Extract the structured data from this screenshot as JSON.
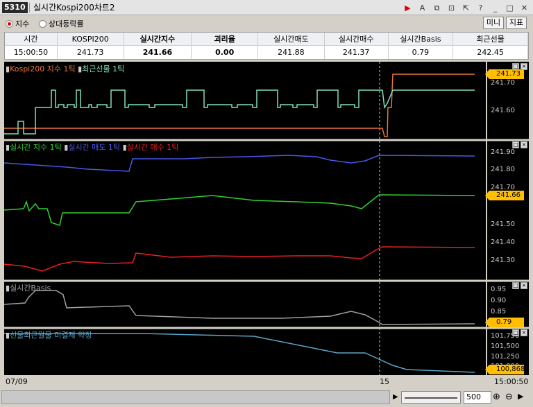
{
  "window": {
    "code": "5310",
    "title": "실시간Kospi200차트2"
  },
  "toolbar": {
    "radio1": "지수",
    "radio2": "상대등락률",
    "mini_btn": "미니",
    "indicator_btn": "지표"
  },
  "grid": {
    "headers": [
      "시간",
      "KOSPI200",
      "실시간지수",
      "괴리율",
      "실시간매도",
      "실시간매수",
      "실시간Basis",
      "최근선물"
    ],
    "values": [
      "15:00:50",
      "241.73",
      "241.66",
      "0.00",
      "241.88",
      "241.37",
      "0.79",
      "242.45"
    ]
  },
  "colors": {
    "kospi": "#e8743a",
    "futures": "#7fe0c0",
    "index": "#2fd22f",
    "sell": "#4a58e8",
    "buy": "#e81f1f",
    "basis": "#a0a0a0",
    "openint": "#5aa6c8",
    "tag": "#ffbf00"
  },
  "panel1": {
    "legend1": "Kospi200 지수 1틱",
    "legend2": "최근선물 1틱",
    "ticks": [
      "241.70",
      "241.60"
    ],
    "tag": "241.73"
  },
  "panel2": {
    "legend1": "실시간 지수 1틱",
    "legend2": "실시간 매도 1틱",
    "legend3": "실시간 매수 1틱",
    "ticks": [
      "241.90",
      "241.80",
      "241.70",
      "241.50",
      "241.40",
      "241.30"
    ],
    "tag": "241.66"
  },
  "panel3": {
    "legend": "실시간Basis",
    "ticks": [
      "0.95",
      "0.90",
      "0.85"
    ],
    "tag": "0.79"
  },
  "panel4": {
    "legend": "선물최근월물 미결제 약정",
    "ticks": [
      "101,750",
      "101,500",
      "101,250",
      "101,000"
    ],
    "tag": "100,868"
  },
  "xaxis": {
    "left": "07/09",
    "mid": "15",
    "right": "15:00:50"
  },
  "zoom": {
    "value": "500"
  }
}
